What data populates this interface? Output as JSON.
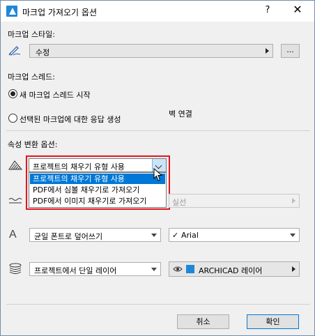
{
  "window": {
    "title": "마크업 가져오기 옵션",
    "help_label": "?",
    "close_label": "✕"
  },
  "markup_style": {
    "label": "마크업 스타일:",
    "icon": "pen-icon",
    "value": "수정",
    "browse_label": "..."
  },
  "markup_thread": {
    "label": "마크업 스레드:",
    "options": [
      {
        "label": "새 마크업 스레드 시작",
        "checked": true
      },
      {
        "label": "선택된 마크업에 대한 응답 생성",
        "checked": false
      }
    ],
    "side_text": "벽 연결"
  },
  "attribute_options": {
    "label": "속성 변환 옵션:",
    "fill": {
      "icon": "fill-pattern-icon",
      "selected": "프로젝트의 채우기 유형 사용",
      "options": [
        "프로젝트의 채우기 유형 사용",
        "PDF에서 심볼 채우기로 가져오기",
        "PDF에서 이미지 채우기로 가져오기"
      ]
    },
    "line": {
      "icon": "line-type-icon",
      "right_value": "실선"
    },
    "font": {
      "icon": "font-icon",
      "glyph": "A",
      "value": "균일 폰트로 덮어쓰기",
      "font_value": "Arial",
      "font_check": "✓"
    },
    "layer": {
      "icon": "layers-icon",
      "value": "프로젝트에서 단일 레이어",
      "layer_value": "ARCHICAD 레이어"
    }
  },
  "footer": {
    "cancel_label": "취소",
    "ok_label": "확인"
  },
  "colors": {
    "highlight": "#e0161f",
    "selection": "#0078d7",
    "brand": "#1e88d8"
  }
}
